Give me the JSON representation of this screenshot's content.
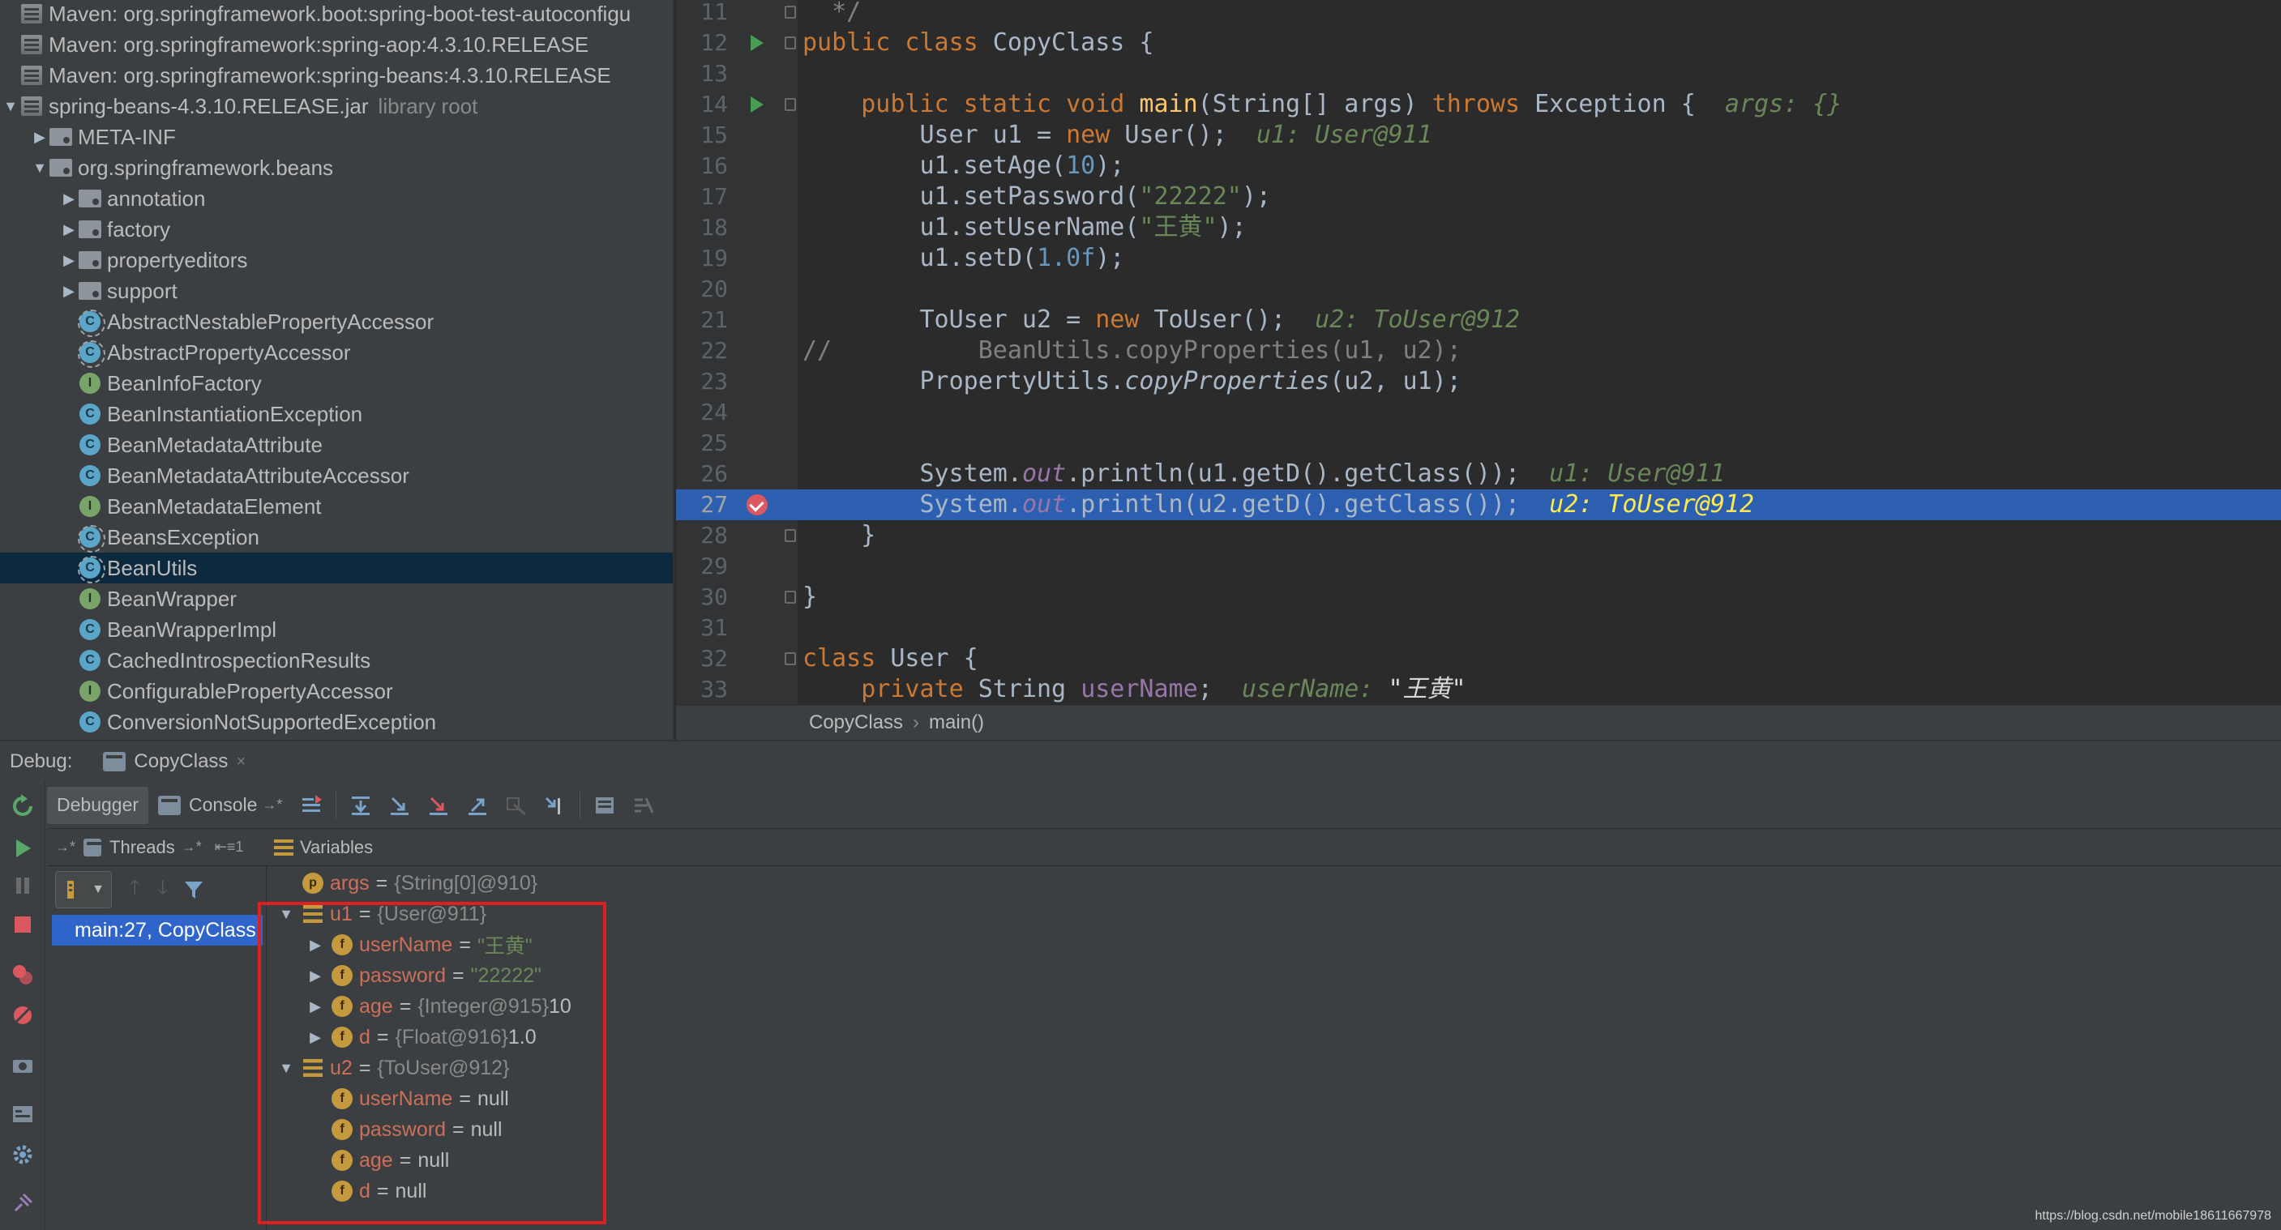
{
  "project_tree": [
    {
      "icon": "library-icon",
      "label": "Maven: org.springframework.boot:spring-boot-test-autoconfigu",
      "depth": 0,
      "arrow": "",
      "extra": ""
    },
    {
      "icon": "library-icon",
      "label": "Maven: org.springframework:spring-aop:4.3.10.RELEASE",
      "depth": 0,
      "arrow": "",
      "extra": ""
    },
    {
      "icon": "library-icon",
      "label": "Maven: org.springframework:spring-beans:4.3.10.RELEASE",
      "depth": 0,
      "arrow": "",
      "extra": ""
    },
    {
      "icon": "jar-icon",
      "label": "spring-beans-4.3.10.RELEASE.jar",
      "depth": 0,
      "arrow": "▼",
      "extra": "library root"
    },
    {
      "icon": "package-icon",
      "label": "META-INF",
      "depth": 1,
      "arrow": "▶",
      "extra": ""
    },
    {
      "icon": "package-icon",
      "label": "org.springframework.beans",
      "depth": 1,
      "arrow": "▼",
      "extra": ""
    },
    {
      "icon": "package-icon",
      "label": "annotation",
      "depth": 2,
      "arrow": "▶",
      "extra": ""
    },
    {
      "icon": "package-icon",
      "label": "factory",
      "depth": 2,
      "arrow": "▶",
      "extra": ""
    },
    {
      "icon": "package-icon",
      "label": "propertyeditors",
      "depth": 2,
      "arrow": "▶",
      "extra": ""
    },
    {
      "icon": "package-icon",
      "label": "support",
      "depth": 2,
      "arrow": "▶",
      "extra": ""
    },
    {
      "icon": "abstract-class-icon",
      "label": "AbstractNestablePropertyAccessor",
      "depth": 2,
      "arrow": "",
      "extra": ""
    },
    {
      "icon": "abstract-class-icon",
      "label": "AbstractPropertyAccessor",
      "depth": 2,
      "arrow": "",
      "extra": ""
    },
    {
      "icon": "interface-icon",
      "label": "BeanInfoFactory",
      "depth": 2,
      "arrow": "",
      "extra": ""
    },
    {
      "icon": "class-icon",
      "label": "BeanInstantiationException",
      "depth": 2,
      "arrow": "",
      "extra": ""
    },
    {
      "icon": "class-icon",
      "label": "BeanMetadataAttribute",
      "depth": 2,
      "arrow": "",
      "extra": ""
    },
    {
      "icon": "class-icon",
      "label": "BeanMetadataAttributeAccessor",
      "depth": 2,
      "arrow": "",
      "extra": ""
    },
    {
      "icon": "interface-icon",
      "label": "BeanMetadataElement",
      "depth": 2,
      "arrow": "",
      "extra": ""
    },
    {
      "icon": "abstract-class-icon",
      "label": "BeansException",
      "depth": 2,
      "arrow": "",
      "extra": ""
    },
    {
      "icon": "abstract-class-icon",
      "label": "BeanUtils",
      "depth": 2,
      "arrow": "",
      "extra": "",
      "selected": true
    },
    {
      "icon": "interface-icon",
      "label": "BeanWrapper",
      "depth": 2,
      "arrow": "",
      "extra": ""
    },
    {
      "icon": "class-icon",
      "label": "BeanWrapperImpl",
      "depth": 2,
      "arrow": "",
      "extra": ""
    },
    {
      "icon": "class-icon",
      "label": "CachedIntrospectionResults",
      "depth": 2,
      "arrow": "",
      "extra": ""
    },
    {
      "icon": "interface-icon",
      "label": "ConfigurablePropertyAccessor",
      "depth": 2,
      "arrow": "",
      "extra": ""
    },
    {
      "icon": "class-icon",
      "label": "ConversionNotSupportedException",
      "depth": 2,
      "arrow": "",
      "extra": ""
    }
  ],
  "editor": {
    "lines": [
      {
        "n": "11",
        "html": "  <span class='cmt'>*/</span>",
        "marker": "",
        "fold": true
      },
      {
        "n": "12",
        "html": "<span class='kw'>public class</span> CopyClass {",
        "marker": "run",
        "fold": true
      },
      {
        "n": "13",
        "html": "",
        "marker": "",
        "fold": false
      },
      {
        "n": "14",
        "html": "    <span class='kw'>public static void</span> <span style='color:#ffc66d'>main</span>(String[] args) <span class='kw'>throws</span> Exception {  <span class='hint'>args: {}</span>",
        "marker": "run",
        "fold": true
      },
      {
        "n": "15",
        "html": "        User u1 = <span class='kw'>new</span> User();  <span class='hint'>u1: User@911</span>",
        "marker": "",
        "fold": false
      },
      {
        "n": "16",
        "html": "        u1.setAge(<span class='num'>10</span>);",
        "marker": "",
        "fold": false
      },
      {
        "n": "17",
        "html": "        u1.setPassword(<span class='str'>\"22222\"</span>);",
        "marker": "",
        "fold": false
      },
      {
        "n": "18",
        "html": "        u1.setUserName(<span class='str'>\"王黄\"</span>);",
        "marker": "",
        "fold": false
      },
      {
        "n": "19",
        "html": "        u1.setD(<span class='num'>1.0f</span>);",
        "marker": "",
        "fold": false
      },
      {
        "n": "20",
        "html": "",
        "marker": "",
        "fold": false
      },
      {
        "n": "21",
        "html": "        ToUser u2 = <span class='kw'>new</span> ToUser();  <span class='hint'>u2: ToUser@912</span>",
        "marker": "",
        "fold": false
      },
      {
        "n": "22",
        "html": "<span class='cmt'>//          BeanUtils.copyProperties(u1, u2);</span>",
        "marker": "",
        "fold": false
      },
      {
        "n": "23",
        "html": "        PropertyUtils.<span class='static'>copyProperties</span>(u2, u1);",
        "marker": "",
        "fold": false
      },
      {
        "n": "24",
        "html": "",
        "marker": "",
        "fold": false
      },
      {
        "n": "25",
        "html": "",
        "marker": "",
        "fold": false
      },
      {
        "n": "26",
        "html": "        System.<span class='fld'>out</span>.println(u1.getD().getClass());  <span class='hint'>u1: User@911</span>",
        "marker": "",
        "fold": false
      },
      {
        "n": "27",
        "html": "        System.<span class='fld'>out</span>.println(u2.getD().getClass());  <span class='hint-sel'>u2: ToUser@912</span>",
        "marker": "breakpoint",
        "fold": false,
        "current": true
      },
      {
        "n": "28",
        "html": "    }",
        "marker": "",
        "fold": true
      },
      {
        "n": "29",
        "html": "",
        "marker": "",
        "fold": false
      },
      {
        "n": "30",
        "html": "}",
        "marker": "",
        "fold": true
      },
      {
        "n": "31",
        "html": "",
        "marker": "",
        "fold": false
      },
      {
        "n": "32",
        "html": "<span class='kw'>class</span> User {",
        "marker": "",
        "fold": true
      },
      {
        "n": "33",
        "html": "    <span class='kw'>private</span> String <span class='purp'>userName</span>;  <span class='hint'>userName: <span style='color:#d8d8d8'>\"王黄\"</span></span>",
        "marker": "",
        "fold": false
      }
    ]
  },
  "breadcrumb": {
    "items": [
      "CopyClass",
      "main()"
    ],
    "separator": "›"
  },
  "debug": {
    "label": "Debug:",
    "session_tab": "CopyClass",
    "close": "×",
    "tabs": {
      "debugger": "Debugger",
      "console": "Console"
    },
    "threads_label": "Threads",
    "variables_label": "Variables",
    "frame": "main:27, CopyClass"
  },
  "variables": [
    {
      "depth": 0,
      "arrow": "",
      "icon": "p",
      "name": "args",
      "type": "{String[0]@910}",
      "value": "",
      "value_is_string": false
    },
    {
      "depth": 0,
      "arrow": "▼",
      "icon": "obj",
      "name": "u1",
      "type": "{User@911}",
      "value": "",
      "value_is_string": false
    },
    {
      "depth": 1,
      "arrow": "▶",
      "icon": "f",
      "name": "userName",
      "type": "",
      "value": "\"王黄\"",
      "value_is_string": true
    },
    {
      "depth": 1,
      "arrow": "▶",
      "icon": "f",
      "name": "password",
      "type": "",
      "value": "\"22222\"",
      "value_is_string": true
    },
    {
      "depth": 1,
      "arrow": "▶",
      "icon": "f",
      "name": "age",
      "type": "{Integer@915}",
      "value": "10",
      "value_is_string": false
    },
    {
      "depth": 1,
      "arrow": "▶",
      "icon": "f",
      "name": "d",
      "type": "{Float@916}",
      "value": "1.0",
      "value_is_string": false
    },
    {
      "depth": 0,
      "arrow": "▼",
      "icon": "obj",
      "name": "u2",
      "type": "{ToUser@912}",
      "value": "",
      "value_is_string": false
    },
    {
      "depth": 1,
      "arrow": "",
      "icon": "f",
      "name": "userName",
      "type": "",
      "value": "null",
      "value_is_string": false
    },
    {
      "depth": 1,
      "arrow": "",
      "icon": "f",
      "name": "password",
      "type": "",
      "value": "null",
      "value_is_string": false
    },
    {
      "depth": 1,
      "arrow": "",
      "icon": "f",
      "name": "age",
      "type": "",
      "value": "null",
      "value_is_string": false
    },
    {
      "depth": 1,
      "arrow": "",
      "icon": "f",
      "name": "d",
      "type": "",
      "value": "null",
      "value_is_string": false
    }
  ],
  "watermark": "https://blog.csdn.net/mobile18611667978"
}
